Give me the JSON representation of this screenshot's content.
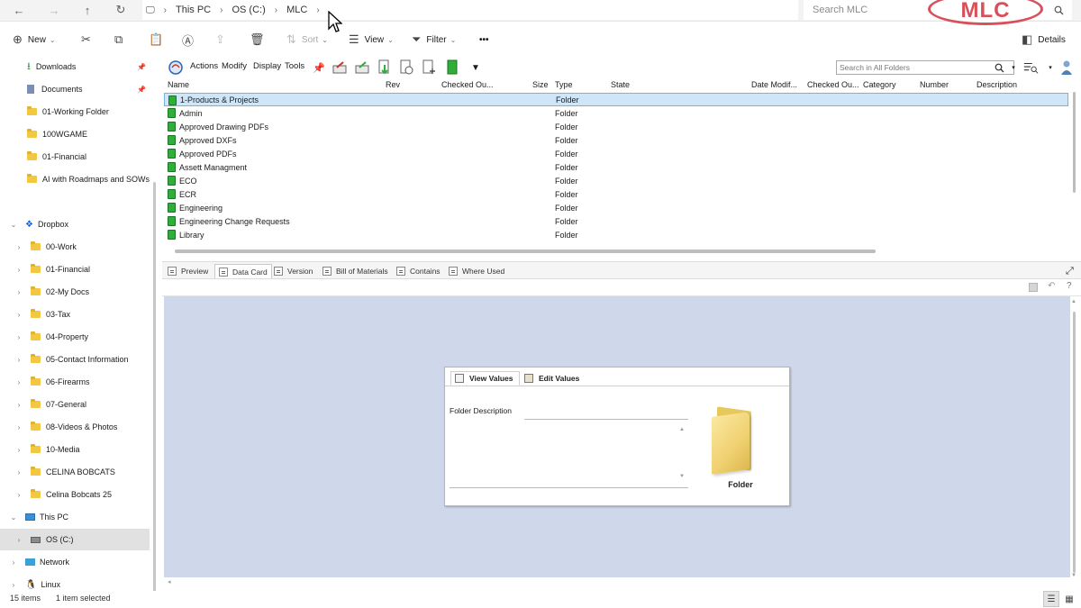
{
  "navbar": {
    "back_icon": "←",
    "forward_icon": "→",
    "up_icon": "↑",
    "refresh_icon": "↻",
    "pc_icon": "🖵",
    "breadcrumbs": [
      "This PC",
      "OS (C:)",
      "MLC"
    ],
    "search_placeholder": "Search MLC",
    "logo_text": "MLC"
  },
  "commandbar": {
    "new_label": "New",
    "sort_label": "Sort",
    "view_label": "View",
    "filter_label": "Filter",
    "more_label": "•••",
    "details_label": "Details"
  },
  "sidebar": {
    "quick_access": [
      {
        "label": "Downloads",
        "pinned": true
      },
      {
        "label": "Documents",
        "pinned": true
      },
      {
        "label": "01-Working Folder"
      },
      {
        "label": "100WGAME"
      },
      {
        "label": "01-Financial"
      },
      {
        "label": "AI with Roadmaps and SOWs"
      }
    ],
    "dropbox_label": "Dropbox",
    "dropbox_items": [
      {
        "label": "00-Work"
      },
      {
        "label": "01-Financial"
      },
      {
        "label": "02-My Docs"
      },
      {
        "label": "03-Tax"
      },
      {
        "label": "04-Property"
      },
      {
        "label": "05-Contact Information"
      },
      {
        "label": "06-Firearms"
      },
      {
        "label": "07-General"
      },
      {
        "label": "08-Videos & Photos"
      },
      {
        "label": "10-Media"
      },
      {
        "label": "CELINA BOBCATS"
      },
      {
        "label": "Celina Bobcats 25"
      }
    ],
    "thispc_label": "This PC",
    "osc_label": "OS (C:)",
    "network_label": "Network",
    "linux_label": "Linux"
  },
  "pdm": {
    "menus": [
      "Actions",
      "Modify",
      "Display",
      "Tools"
    ],
    "search_placeholder": "Search in All Folders",
    "columns": {
      "name": "Name",
      "rev": "Rev",
      "checked_out": "Checked Ou...",
      "size": "Size",
      "type": "Type",
      "state": "State",
      "date_modified": "Date Modif...",
      "checked_out2": "Checked Ou...",
      "category": "Category",
      "number": "Number",
      "description": "Description"
    },
    "files": [
      {
        "name": "1-Products & Projects",
        "type": "Folder",
        "selected": true
      },
      {
        "name": "Admin",
        "type": "Folder"
      },
      {
        "name": "Approved Drawing PDFs",
        "type": "Folder"
      },
      {
        "name": "Approved DXFs",
        "type": "Folder"
      },
      {
        "name": "Approved PDFs",
        "type": "Folder"
      },
      {
        "name": "Assett Managment",
        "type": "Folder"
      },
      {
        "name": "ECO",
        "type": "Folder"
      },
      {
        "name": "ECR",
        "type": "Folder"
      },
      {
        "name": "Engineering",
        "type": "Folder"
      },
      {
        "name": "Engineering Change Requests",
        "type": "Folder"
      },
      {
        "name": "Library",
        "type": "Folder"
      }
    ],
    "tabs": [
      "Preview",
      "Data Card",
      "Version",
      "Bill of Materials",
      "Contains",
      "Where Used"
    ],
    "active_tab": "Data Card",
    "datacard": {
      "view_values_label": "View Values",
      "edit_values_label": "Edit Values",
      "folder_description_label": "Folder Description",
      "folder_label": "Folder"
    }
  },
  "status": {
    "item_count": "15 items",
    "selection": "1 item selected"
  },
  "colors": {
    "accent_selected_row": "#cfe6f8",
    "card_background": "#cfd8ea",
    "logo_red": "#d8505a",
    "pdm_folder_green": "#2fae3a"
  }
}
